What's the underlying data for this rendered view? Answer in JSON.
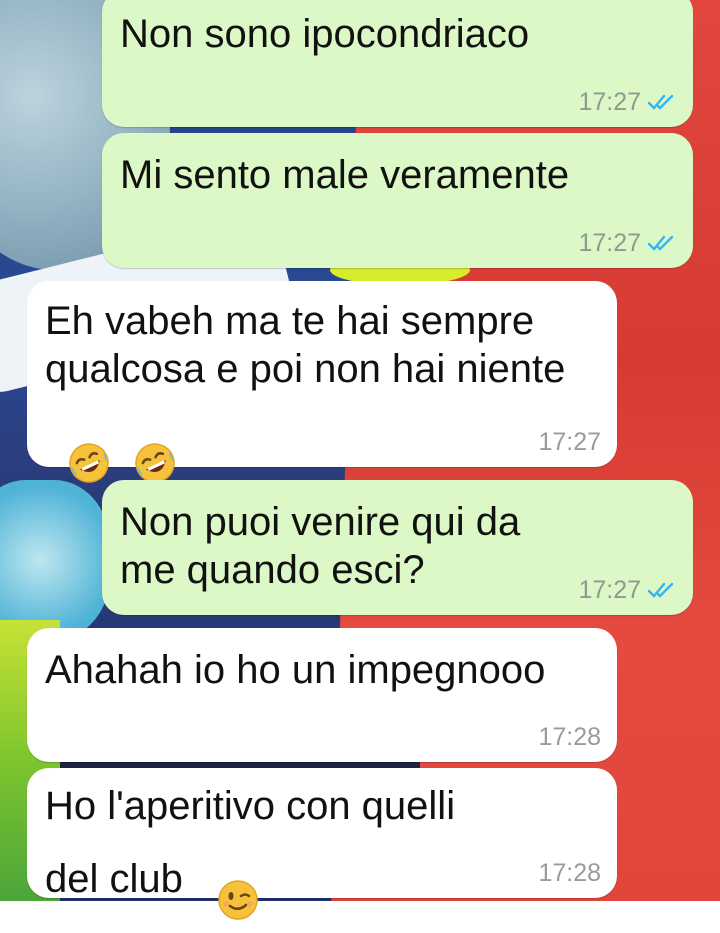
{
  "messages": [
    {
      "text": "Non sono ipocondriaco",
      "time": "17:27",
      "direction": "outgoing",
      "read": true
    },
    {
      "text": "Mi sento male veramente",
      "time": "17:27",
      "direction": "outgoing",
      "read": true
    },
    {
      "text": "Eh vabeh ma te hai sempre qualcosa e poi non hai niente",
      "emojis": [
        "rolling-on-floor-laughing",
        "rolling-on-floor-laughing"
      ],
      "time": "17:27",
      "direction": "incoming"
    },
    {
      "text": "Non puoi venire qui da me quando esci?",
      "time": "17:27",
      "direction": "outgoing",
      "read": true
    },
    {
      "text": "Ahahah io ho un impegnooo",
      "time": "17:28",
      "direction": "incoming"
    },
    {
      "text": "Ho l'aperitivo con quelli del club",
      "emojis": [
        "winking-face"
      ],
      "time": "17:28",
      "direction": "incoming"
    }
  ],
  "colors": {
    "outgoing_bubble": "#dcf8c6",
    "incoming_bubble": "#ffffff",
    "read_ticks": "#34b7f1"
  },
  "icons": {
    "read_receipt": "double-check-icon"
  }
}
